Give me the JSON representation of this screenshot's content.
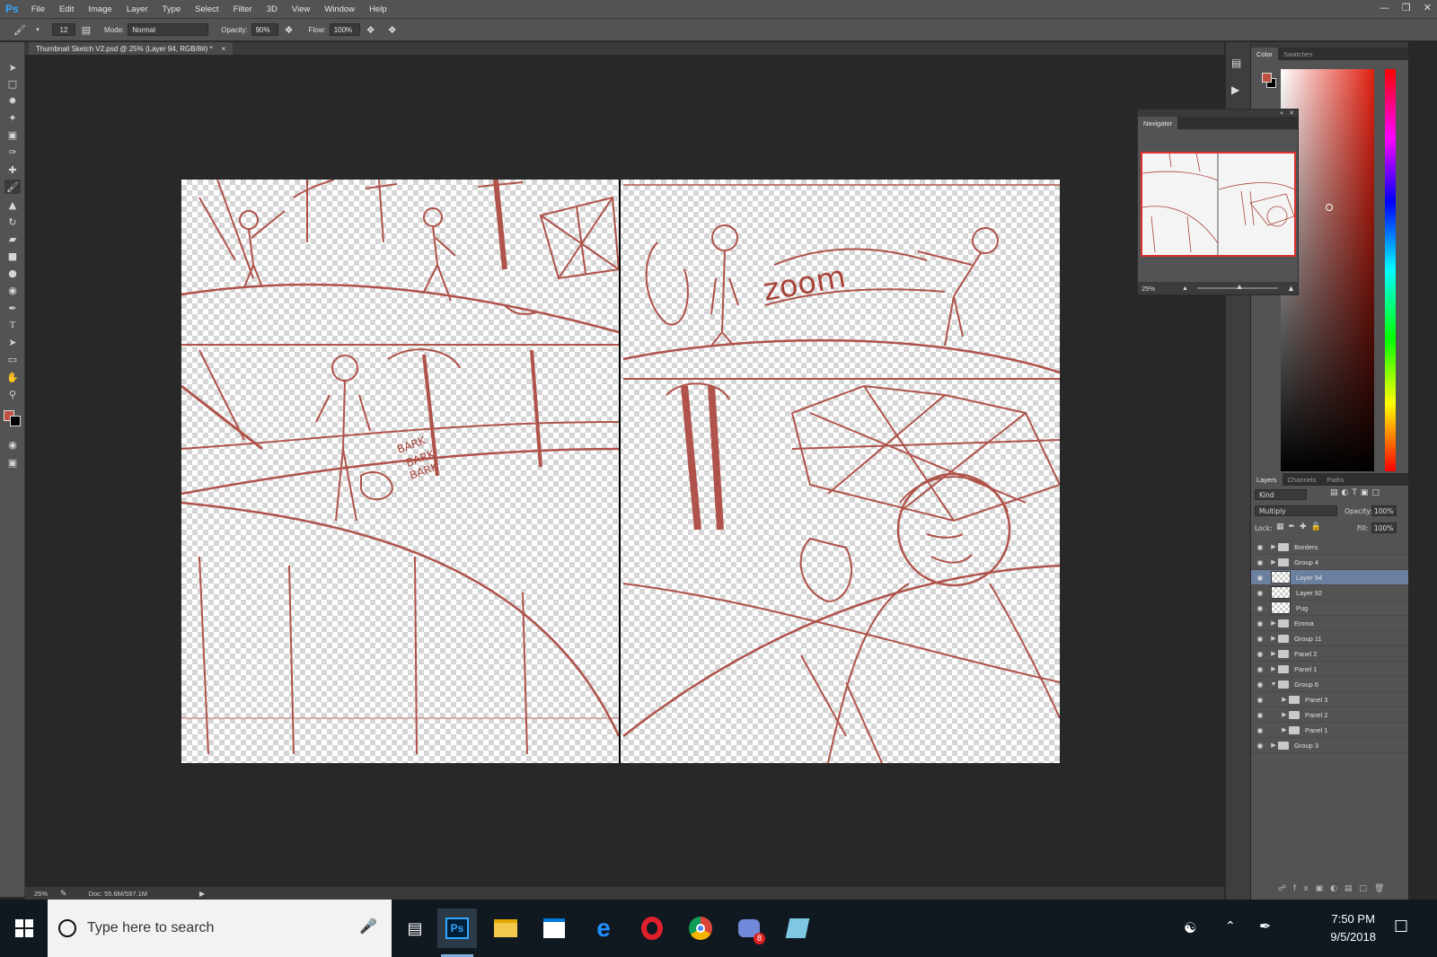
{
  "app": {
    "logo": "Ps",
    "menu": [
      "File",
      "Edit",
      "Image",
      "Layer",
      "Type",
      "Select",
      "Filter",
      "3D",
      "View",
      "Window",
      "Help"
    ],
    "accent_color": "#31a8ff"
  },
  "options_bar": {
    "brush_size": "12",
    "mode_label": "Mode:",
    "mode_value": "Normal",
    "opacity_label": "Opacity:",
    "opacity_value": "90%",
    "flow_label": "Flow:",
    "flow_value": "100%"
  },
  "document": {
    "tab_title": "Thumbnail Sketch V2.psd @ 25% (Layer 94, RGB/8#) *",
    "tab_close": "×",
    "sketch_color": "#a9433a"
  },
  "canvas_art": {
    "sfx_zoom": "zoom",
    "sfx_bark_1": "BARK",
    "sfx_bark_2": "BARK",
    "sfx_bark_3": "BARK"
  },
  "status_bar": {
    "zoom": "25%",
    "doc_size": "Doc: 55.6M/597.1M"
  },
  "color_panel": {
    "tabs": [
      "Color",
      "Swatches"
    ],
    "foreground": "#c0503f",
    "background": "#000000"
  },
  "navigator": {
    "title": "Navigator",
    "zoom": "25%"
  },
  "layers_panel": {
    "tabs": [
      "Layers",
      "Channels",
      "Paths"
    ],
    "filter_kind": "Kind",
    "blend_mode": "Multiply",
    "opacity_label": "Opacity:",
    "opacity_value": "100%",
    "lock_label": "Lock:",
    "fill_label": "Fill:",
    "fill_value": "100%",
    "layers": [
      {
        "name": "Borders",
        "type": "group",
        "expanded": false,
        "indent": 0,
        "selected": false
      },
      {
        "name": "Group 4",
        "type": "group",
        "expanded": false,
        "indent": 0,
        "selected": false
      },
      {
        "name": "Layer 94",
        "type": "layer",
        "indent": 0,
        "selected": true
      },
      {
        "name": "Layer 92",
        "type": "layer",
        "indent": 0,
        "selected": false
      },
      {
        "name": "Pug",
        "type": "layer",
        "indent": 0,
        "selected": false
      },
      {
        "name": "Emma",
        "type": "group",
        "expanded": false,
        "indent": 0,
        "selected": false
      },
      {
        "name": "Group 11",
        "type": "group",
        "expanded": false,
        "indent": 0,
        "selected": false
      },
      {
        "name": "Panel 2",
        "type": "group",
        "expanded": false,
        "indent": 0,
        "selected": false
      },
      {
        "name": "Panel 1",
        "type": "group",
        "expanded": false,
        "indent": 0,
        "selected": false
      },
      {
        "name": "Group 6",
        "type": "group",
        "expanded": true,
        "indent": 0,
        "selected": false
      },
      {
        "name": "Panel 3",
        "type": "group",
        "expanded": false,
        "indent": 1,
        "selected": false
      },
      {
        "name": "Panel 2",
        "type": "group",
        "expanded": false,
        "indent": 1,
        "selected": false
      },
      {
        "name": "Panel 1",
        "type": "group",
        "expanded": false,
        "indent": 1,
        "selected": false
      },
      {
        "name": "Group 3",
        "type": "group",
        "expanded": false,
        "indent": 0,
        "selected": false
      }
    ]
  },
  "taskbar": {
    "search_placeholder": "Type here to search",
    "time": "7:50 PM",
    "date": "9/5/2018",
    "discord_badge": "8"
  }
}
